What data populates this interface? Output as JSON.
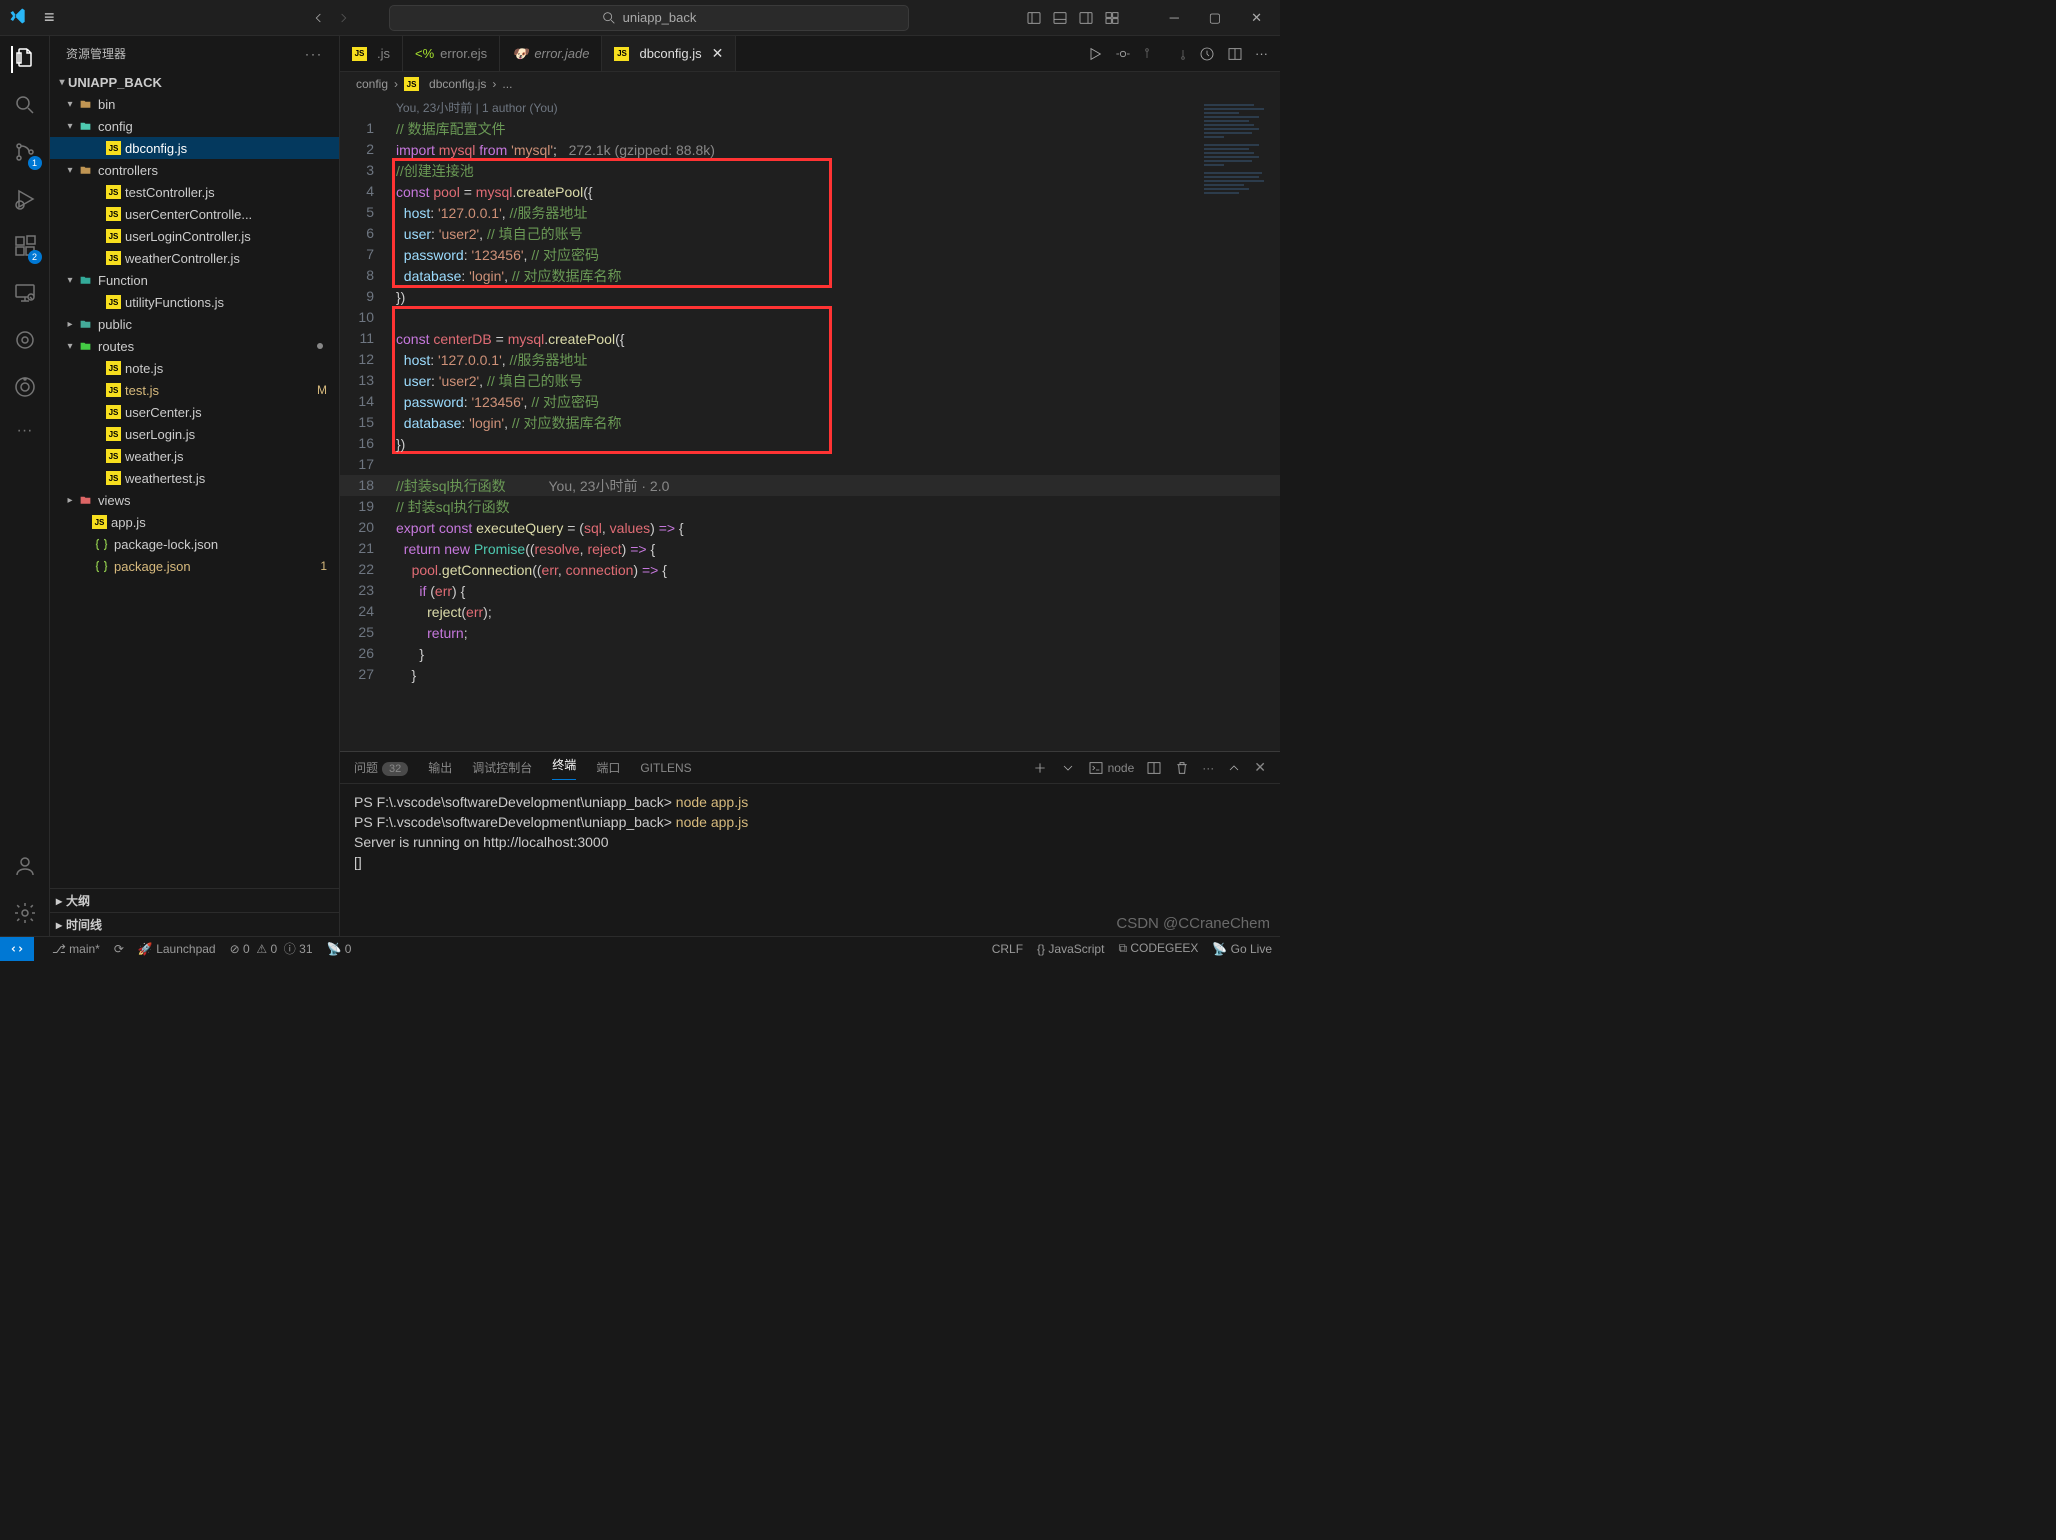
{
  "title": {
    "search_text": "uniapp_back"
  },
  "sidebar": {
    "header": "资源管理器",
    "project": "UNIAPP_BACK",
    "items": [
      {
        "indent": 14,
        "chev": "▾",
        "name": "bin",
        "icon": "folder",
        "col": "#c09553"
      },
      {
        "indent": 14,
        "chev": "▾",
        "name": "config",
        "icon": "folder",
        "col": "#4ec9b0",
        "sel": false
      },
      {
        "indent": 44,
        "name": "dbconfig.js",
        "icon": "js",
        "sel": true
      },
      {
        "indent": 14,
        "chev": "▾",
        "name": "controllers",
        "icon": "folder",
        "col": "#c09553"
      },
      {
        "indent": 44,
        "name": "testController.js",
        "icon": "js"
      },
      {
        "indent": 44,
        "name": "userCenterControlle...",
        "icon": "js"
      },
      {
        "indent": 44,
        "name": "userLoginController.js",
        "icon": "js"
      },
      {
        "indent": 44,
        "name": "weatherController.js",
        "icon": "js"
      },
      {
        "indent": 14,
        "chev": "▾",
        "name": "Function",
        "icon": "folder",
        "col": "#3a9"
      },
      {
        "indent": 44,
        "name": "utilityFunctions.js",
        "icon": "js"
      },
      {
        "indent": 14,
        "chev": "▸",
        "name": "public",
        "icon": "folder",
        "col": "#4a9"
      },
      {
        "indent": 14,
        "chev": "▾",
        "name": "routes",
        "icon": "folder",
        "col": "#4c4",
        "dot": true
      },
      {
        "indent": 44,
        "name": "note.js",
        "icon": "js"
      },
      {
        "indent": 44,
        "name": "test.js",
        "icon": "js",
        "mod": "M"
      },
      {
        "indent": 44,
        "name": "userCenter.js",
        "icon": "js"
      },
      {
        "indent": 44,
        "name": "userLogin.js",
        "icon": "js"
      },
      {
        "indent": 44,
        "name": "weather.js",
        "icon": "js"
      },
      {
        "indent": 44,
        "name": "weathertest.js",
        "icon": "js"
      },
      {
        "indent": 14,
        "chev": "▸",
        "name": "views",
        "icon": "folder",
        "col": "#d66"
      },
      {
        "indent": 30,
        "name": "app.js",
        "icon": "js"
      },
      {
        "indent": 30,
        "name": "package-lock.json",
        "icon": "json"
      },
      {
        "indent": 30,
        "name": "package.json",
        "icon": "json",
        "mod": "1"
      }
    ],
    "sections": [
      "大纲",
      "时间线"
    ]
  },
  "tabs": [
    {
      "label": ".js",
      "icon": "js",
      "partial": true
    },
    {
      "label": "error.ejs",
      "icon": "ejs"
    },
    {
      "label": "error.jade",
      "icon": "jade",
      "italic": true
    },
    {
      "label": "dbconfig.js",
      "icon": "js",
      "active": true,
      "close": true
    }
  ],
  "breadcrumb": [
    "config",
    "dbconfig.js",
    "..."
  ],
  "author": "You, 23小时前 | 1 author (You)",
  "code_lines": 27,
  "gzip": "272.1k (gzipped: 88.8k)",
  "panel": {
    "tabs": [
      {
        "l": "问题",
        "c": "32"
      },
      {
        "l": "输出"
      },
      {
        "l": "调试控制台"
      },
      {
        "l": "终端",
        "active": true
      },
      {
        "l": "端口"
      },
      {
        "l": "GITLENS"
      }
    ],
    "shell": "node",
    "lines": [
      {
        "prompt": "PS F:\\.vscode\\softwareDevelopment\\uniapp_back> ",
        "cmd": "node app.js"
      },
      {
        "prompt": "PS F:\\.vscode\\softwareDevelopment\\uniapp_back> ",
        "cmd": "node app.js"
      },
      {
        "text": "Server is running on http://localhost:3000"
      },
      {
        "text": "[]"
      }
    ]
  },
  "status": {
    "branch": "main*",
    "launchpad": "Launchpad",
    "errors": "0",
    "warnings": "0",
    "info": "31",
    "radio": "0",
    "crlf": "CRLF",
    "lang": "JavaScript",
    "codegeex": "CODEGEEX",
    "golive": "Go Live"
  },
  "watermark": "CSDN @CCraneChem"
}
